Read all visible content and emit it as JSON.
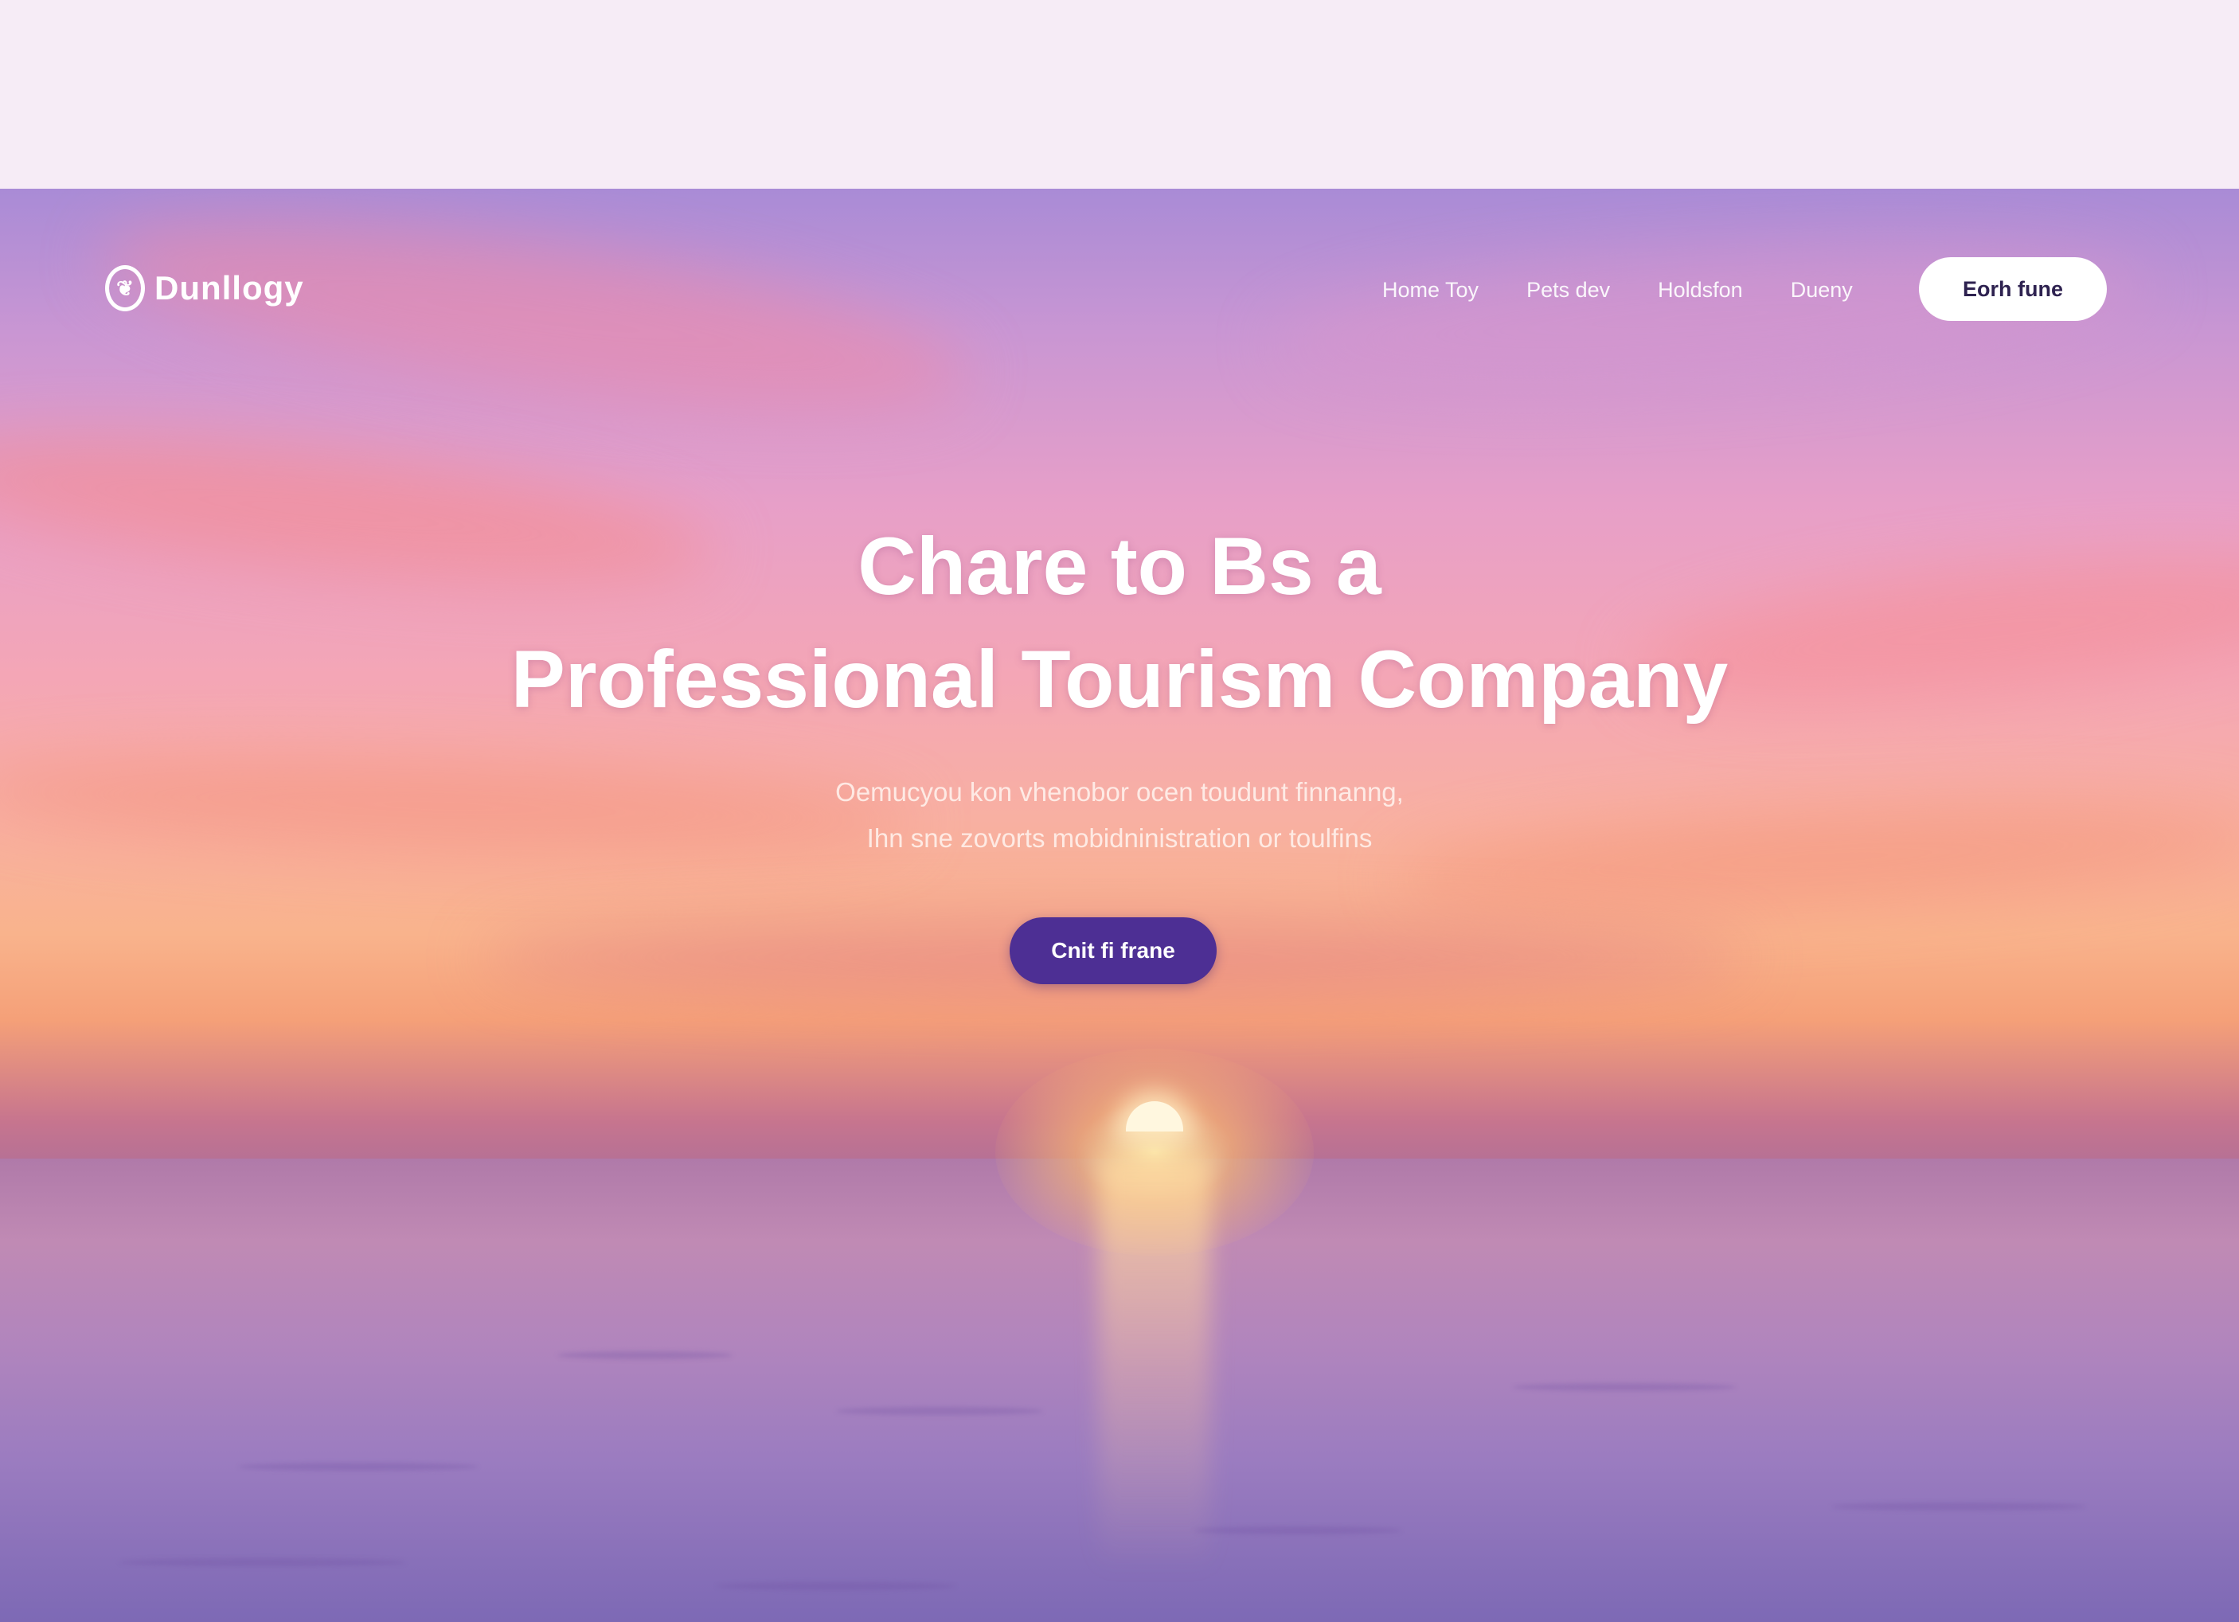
{
  "brand": {
    "name": "Dunllogy"
  },
  "nav": {
    "links": [
      "Home Toy",
      "Pets dev",
      "Holdsfon",
      "Dueny"
    ],
    "cta_label": "Eorh fune"
  },
  "hero": {
    "headline_line1": "Chare to Bs a",
    "headline_line2": "Professional Tourism Company",
    "subtext_line1": "Oemucyou kon vhenobor ocen toudunt finnanng,",
    "subtext_line2": "Ihn sne zovorts mobidninistration or toulfins",
    "cta_label": "Cnit fi frane"
  },
  "colors": {
    "primary_button": "#4d2f94",
    "sky_top": "#a98bd6",
    "sky_mid": "#f4a6b6",
    "horizon": "#f9b38c",
    "sea": "#9b7cc0"
  },
  "icons": {
    "logo": "brand-logo-icon"
  }
}
